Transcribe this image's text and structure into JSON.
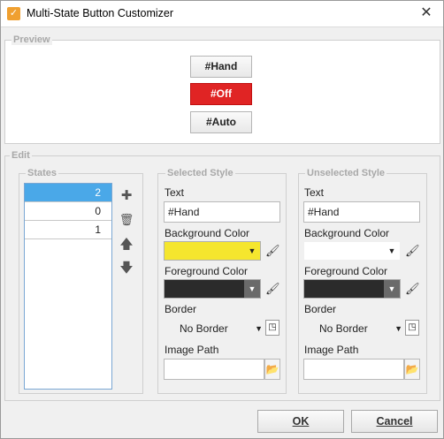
{
  "window": {
    "title": "Multi-State Button Customizer",
    "close_glyph": "✕",
    "app_icon": "checkmark-icon"
  },
  "preview": {
    "legend": "Preview",
    "buttons": [
      {
        "label": "#Hand",
        "state": "normal"
      },
      {
        "label": "#Off",
        "state": "active",
        "color": "#e02424"
      },
      {
        "label": "#Auto",
        "state": "normal"
      }
    ]
  },
  "edit": {
    "legend": "Edit",
    "states": {
      "legend": "States",
      "rows": [
        "2",
        "0",
        "1"
      ],
      "selected_index": 0,
      "tools": [
        {
          "name": "add-state-button",
          "glyph": "✚",
          "icon": "plus-icon"
        },
        {
          "name": "delete-state-button",
          "glyph": "🗑",
          "icon": "trash-icon"
        },
        {
          "name": "move-up-button",
          "glyph": "🡅",
          "icon": "arrow-up-icon"
        },
        {
          "name": "move-down-button",
          "glyph": "🡇",
          "icon": "arrow-down-icon"
        }
      ]
    },
    "selected_style": {
      "legend": "Selected Style",
      "text_label": "Text",
      "text_value": "#Hand",
      "bg_label": "Background Color",
      "bg_color": "#f5e62e",
      "fg_label": "Foreground Color",
      "fg_color": "#2b2b2b",
      "border_label": "Border",
      "border_value": "No Border",
      "image_label": "Image Path",
      "image_value": ""
    },
    "unselected_style": {
      "legend": "Unselected Style",
      "text_label": "Text",
      "text_value": "#Hand",
      "bg_label": "Background Color",
      "bg_color": "#ffffff",
      "fg_label": "Foreground Color",
      "fg_color": "#2b2b2b",
      "border_label": "Border",
      "border_value": "No Border",
      "image_label": "Image Path",
      "image_value": ""
    }
  },
  "footer": {
    "ok_label": "OK",
    "cancel_label": "Cancel"
  },
  "glyphs": {
    "down_arrow": "▼",
    "paint_bucket": "🖌",
    "border_btn": "◳",
    "folder": "📂"
  }
}
